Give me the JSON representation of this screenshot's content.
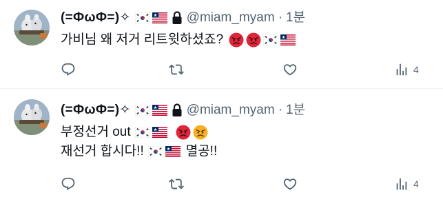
{
  "colors": {
    "text": "#0f1419",
    "secondary": "#536471",
    "divider": "#eff3f4",
    "angry_red": "#e0263a",
    "angry_orange": "#f7b026"
  },
  "tweets": [
    {
      "display_name": "(=ФωФ=)✧",
      "flags": [
        "south-korea-flag",
        "liberia-flag"
      ],
      "locked": true,
      "handle": "@miam_myam",
      "separator": "·",
      "time": "1분",
      "lines": [
        {
          "text": "가비님 왜 저거 리트윗하셨죠?",
          "emojis": [
            "angry-red-face",
            "angry-red-face",
            "south-korea-flag",
            "liberia-flag"
          ]
        }
      ],
      "views": "4"
    },
    {
      "display_name": "(=ФωФ=)✧",
      "flags": [
        "south-korea-flag",
        "liberia-flag"
      ],
      "locked": true,
      "handle": "@miam_myam",
      "separator": "·",
      "time": "1분",
      "lines": [
        {
          "text": "부정선거 out",
          "emojis": [
            "south-korea-flag",
            "liberia-flag",
            "angry-red-face",
            "angry-face"
          ]
        },
        {
          "text": "재선거 합시다!!",
          "emojis": [
            "south-korea-flag",
            "liberia-flag"
          ],
          "suffix": "멸공!!"
        }
      ],
      "views": "4"
    }
  ]
}
